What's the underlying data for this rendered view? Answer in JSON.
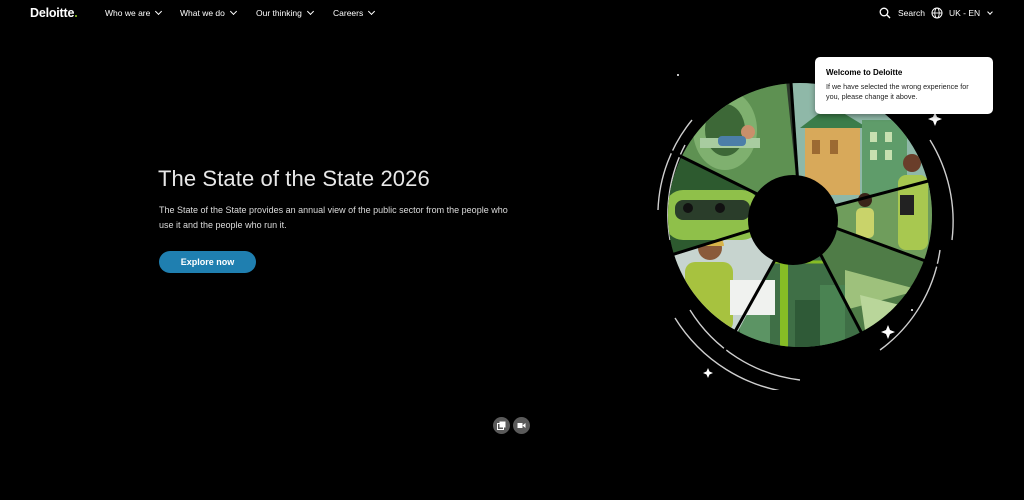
{
  "nav": {
    "logo": "Deloitte",
    "logo_dot": ".",
    "items": [
      {
        "label": "Who we are"
      },
      {
        "label": "What we do"
      },
      {
        "label": "Our thinking"
      },
      {
        "label": "Careers"
      }
    ],
    "search_label": "Search",
    "locale_label": "UK - EN"
  },
  "hero": {
    "title": "The State of the State 2026",
    "description": "The State of the State provides an annual view of the public sector from the people who use it and the people who run it.",
    "cta_label": "Explore now"
  },
  "popup": {
    "title": "Welcome to Deloitte",
    "text": "If we have selected the wrong experience for you, please change it above."
  },
  "colors": {
    "background": "#000000",
    "accent_green": "#86bc25",
    "cta_blue": "#1f7fb0",
    "popup_bg": "#ffffff"
  },
  "icons": {
    "search": "search-icon",
    "globe": "globe-icon",
    "chevron": "chevron-down-icon",
    "gallery": "gallery-icon",
    "video": "video-icon"
  }
}
